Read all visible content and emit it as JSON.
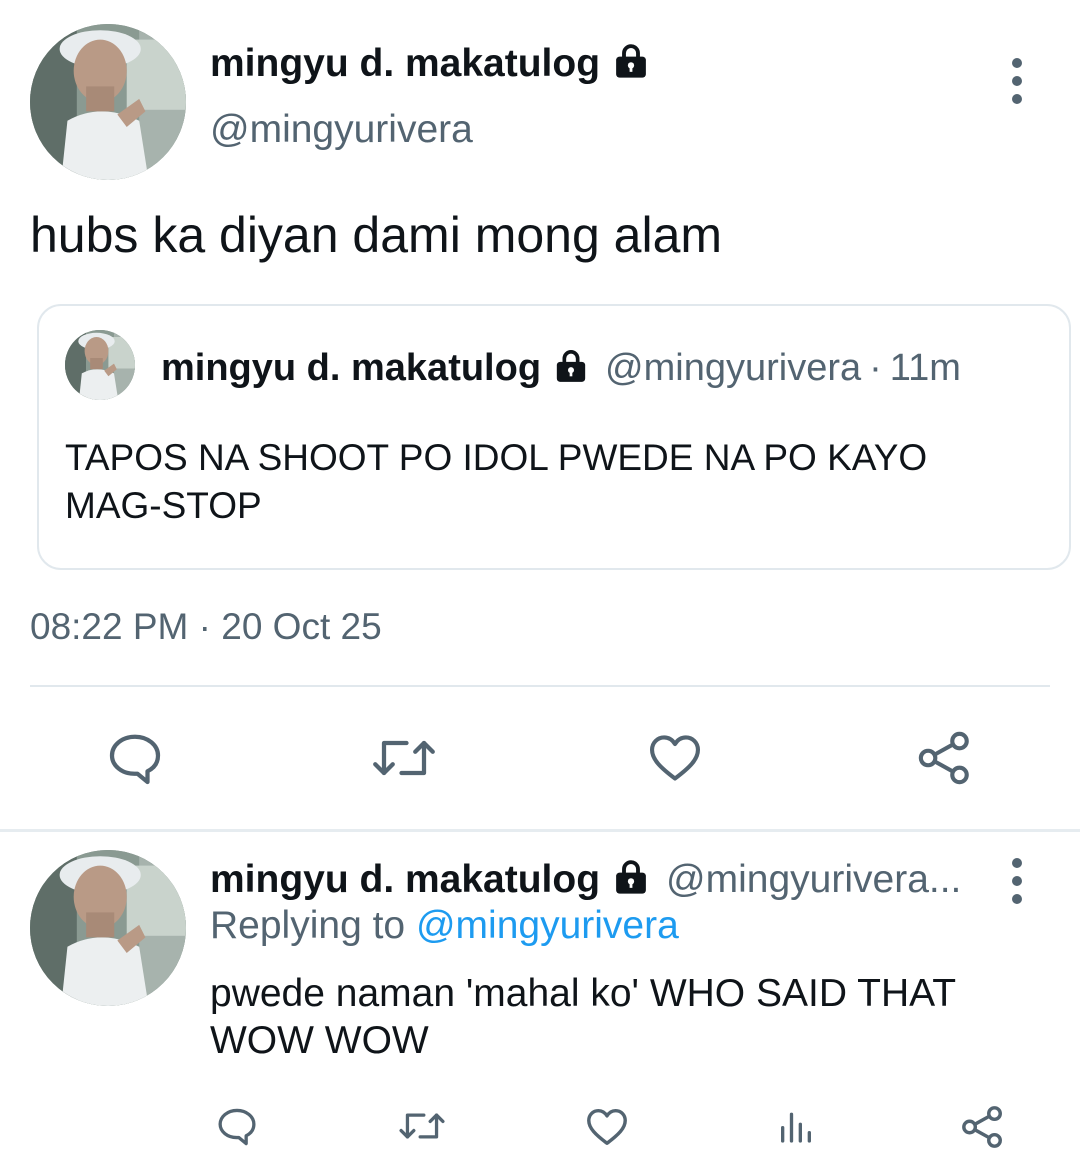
{
  "main_tweet": {
    "display_name": "mingyu d. makatulog",
    "handle": "@mingyurivera",
    "text": "hubs ka diyan dami mong alam",
    "timestamp": "08:22 PM · 20 Oct 25",
    "quoted": {
      "display_name": "mingyu d. makatulog",
      "handle": "@mingyurivera",
      "separator": "·",
      "time": "11m",
      "text": "TAPOS NA SHOOT PO IDOL PWEDE NA PO KAYO MAG-STOP"
    },
    "actions": [
      "reply-icon",
      "retweet-icon",
      "like-icon",
      "share-icon"
    ]
  },
  "reply_tweet": {
    "display_name": "mingyu d. makatulog",
    "handle": "@mingyurivera...",
    "replying_prefix": "Replying to",
    "replying_to": "@mingyurivera",
    "text": "pwede naman 'mahal ko' WHO SAID THAT WOW WOW",
    "actions": [
      "reply-icon",
      "retweet-icon",
      "like-icon",
      "analytics-icon",
      "share-icon"
    ]
  },
  "colors": {
    "text": "#0f1419",
    "secondary": "#536471",
    "link": "#1d9bf0",
    "border": "#e1e8ed"
  }
}
